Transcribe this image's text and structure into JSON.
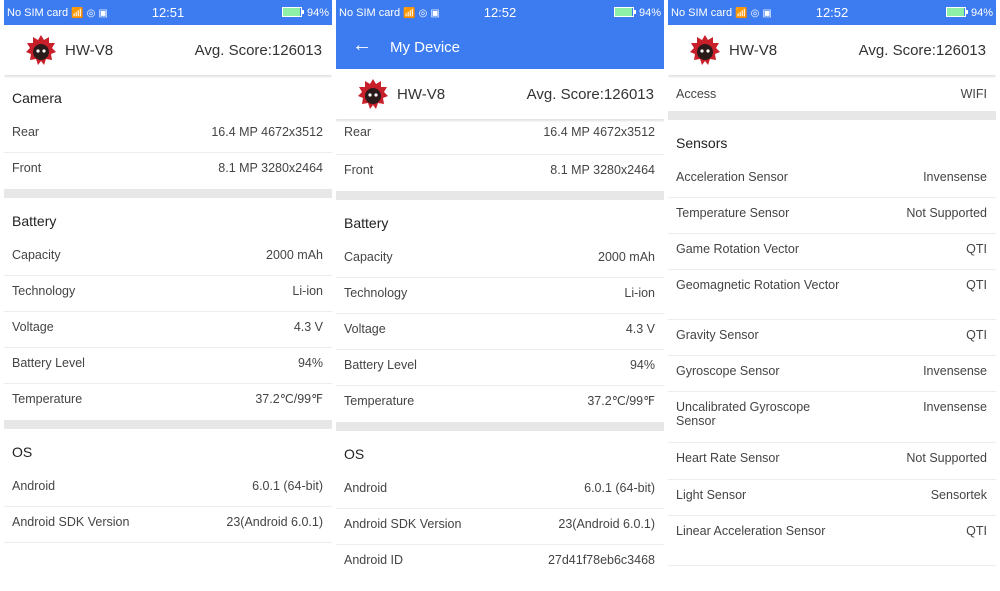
{
  "status_left": "No SIM card",
  "screens": [
    {
      "time": "12:51",
      "battery": "94%",
      "device": "HW-V8",
      "score": "Avg. Score:126013",
      "sections": [
        {
          "title": "Camera",
          "rows": [
            {
              "label": "Rear",
              "value": "16.4 MP 4672x3512"
            },
            {
              "label": "Front",
              "value": "8.1 MP 3280x2464"
            }
          ]
        },
        {
          "title": "Battery",
          "rows": [
            {
              "label": "Capacity",
              "value": "2000 mAh"
            },
            {
              "label": "Technology",
              "value": "Li-ion"
            },
            {
              "label": "Voltage",
              "value": "4.3 V"
            },
            {
              "label": "Battery Level",
              "value": "94%"
            },
            {
              "label": "Temperature",
              "value": "37.2℃/99℉"
            }
          ]
        },
        {
          "title": "OS",
          "rows": [
            {
              "label": "Android",
              "value": "6.0.1 (64-bit)"
            },
            {
              "label": "Android SDK Version",
              "value": "23(Android 6.0.1)"
            }
          ]
        }
      ]
    },
    {
      "time": "12:52",
      "battery": "94%",
      "app_title": "My Device",
      "device": "HW-V8",
      "score": "Avg. Score:126013",
      "sections": [
        {
          "rows": [
            {
              "label": "Rear",
              "value": "16.4 MP 4672x3512"
            },
            {
              "label": "Front",
              "value": "8.1 MP 3280x2464"
            }
          ]
        },
        {
          "title": "Battery",
          "rows": [
            {
              "label": "Capacity",
              "value": "2000 mAh"
            },
            {
              "label": "Technology",
              "value": "Li-ion"
            },
            {
              "label": "Voltage",
              "value": "4.3 V"
            },
            {
              "label": "Battery Level",
              "value": "94%"
            },
            {
              "label": "Temperature",
              "value": "37.2℃/99℉"
            }
          ]
        },
        {
          "title": "OS",
          "rows": [
            {
              "label": "Android",
              "value": "6.0.1 (64-bit)"
            },
            {
              "label": "Android SDK Version",
              "value": "23(Android 6.0.1)"
            },
            {
              "label": "Android ID",
              "value": "27d41f78eb6c3468"
            }
          ]
        }
      ]
    },
    {
      "time": "12:52",
      "battery": "94%",
      "device": "HW-V8",
      "score": "Avg. Score:126013",
      "sections": [
        {
          "rows": [
            {
              "label": "Access",
              "value": "WIFI"
            }
          ]
        },
        {
          "title": "Sensors",
          "rows": [
            {
              "label": "Acceleration Sensor",
              "value": "Invensense"
            },
            {
              "label": "Temperature Sensor",
              "value": "Not Supported"
            },
            {
              "label": "Game Rotation Vector",
              "value": "QTI"
            },
            {
              "label": "Geomagnetic Rotation Vector",
              "value": "QTI"
            },
            {
              "label": "Gravity Sensor",
              "value": "QTI"
            },
            {
              "label": "Gyroscope Sensor",
              "value": "Invensense"
            },
            {
              "label": "Uncalibrated Gyroscope Sensor",
              "value": "Invensense"
            },
            {
              "label": "Heart Rate Sensor",
              "value": "Not Supported"
            },
            {
              "label": "Light Sensor",
              "value": "Sensortek"
            },
            {
              "label": "Linear Acceleration Sensor",
              "value": "QTI"
            }
          ]
        }
      ]
    }
  ],
  "colors": {
    "accent": "#3d7cf0",
    "divider": "#e7e7e7",
    "logo": "#c8202b"
  },
  "icons": [
    "wifi-icon",
    "message-icon",
    "notification-icon",
    "battery-icon",
    "back-arrow-icon",
    "antutu-logo-icon"
  ]
}
